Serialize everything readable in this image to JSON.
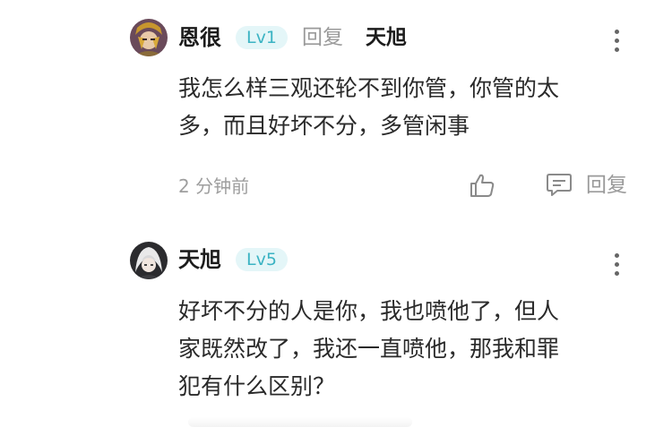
{
  "comments": [
    {
      "username": "恩很",
      "level": "Lv1",
      "reply_word": "回复",
      "reply_target": "天旭",
      "text": "我怎么样三观还轮不到你管，你管的太\n多，而且好坏不分，多管闲事",
      "time": "2 分钟前",
      "reply_label": "回复",
      "avatar_icon": "anime-avatar-icon",
      "more_icon": "more-vertical-icon"
    },
    {
      "username": "天旭",
      "level": "Lv5",
      "text": "好坏不分的人是你，我也喷他了，但人\n家既然改了，我还一直喷他，那我和罪\n犯有什么区别？",
      "avatar_icon": "anime-avatar-icon",
      "more_icon": "more-vertical-icon"
    }
  ],
  "colors": {
    "badge_bg": "#e4f6f8",
    "badge_text": "#3bb3c3",
    "muted": "#9a9a9a"
  },
  "icons": [
    "like-thumb-icon",
    "comment-reply-icon"
  ]
}
